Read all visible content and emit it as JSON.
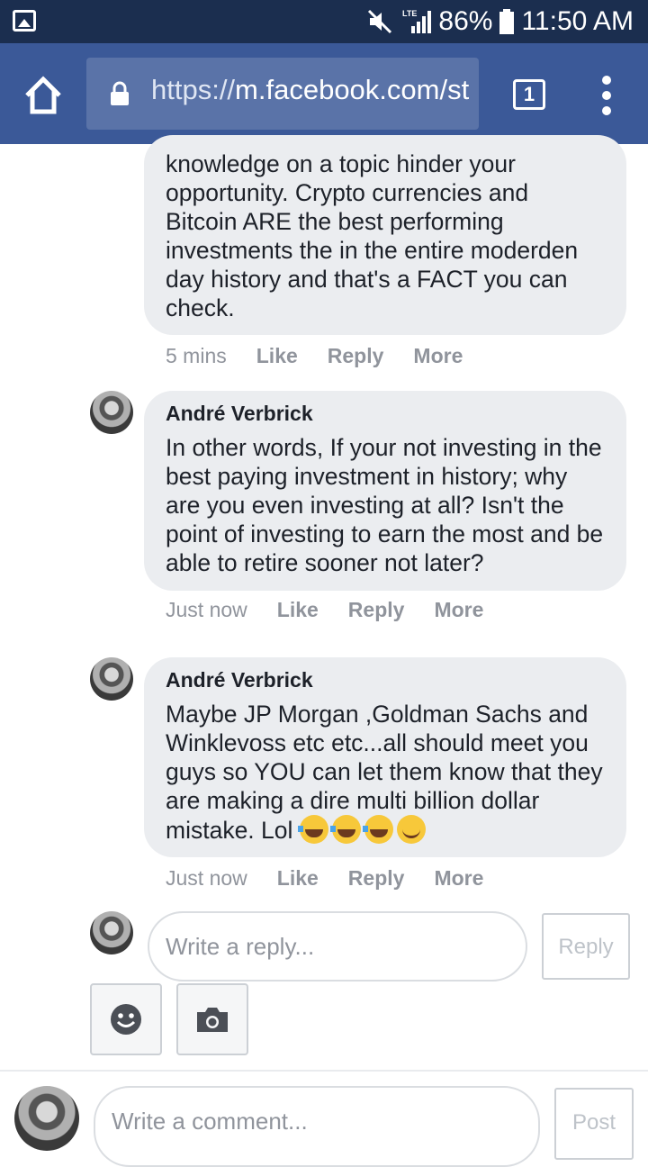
{
  "status_bar": {
    "network_label": "LTE",
    "battery": "86%",
    "time": "11:50 AM"
  },
  "browser": {
    "url_prefix": "https://",
    "url_host": "m.facebook.com/st",
    "tab_count": "1"
  },
  "comments": [
    {
      "author": "",
      "text": "knowledge on a topic hinder your opportunity. Crypto currencies and Bitcoin ARE the best performing investments the in the entire moderden day history and that's a FACT you can check.",
      "time": "5 mins"
    },
    {
      "author": "André Verbrick",
      "text": "In other words, If your not investing in the best paying investment in history; why are you even investing at all? Isn't the point of investing to earn the most and be able to retire sooner not later?",
      "time": "Just now"
    },
    {
      "author": "André Verbrick",
      "text": "Maybe JP Morgan ,Goldman Sachs and Winklevoss etc etc...all should meet you guys so YOU can let them know that they are making a dire multi billion dollar mistake. Lol",
      "time": "Just now",
      "emojis": [
        "face-with-tears-of-joy-icon",
        "face-with-tears-of-joy-icon",
        "face-with-tears-of-joy-icon",
        "smiling-face-icon"
      ]
    }
  ],
  "actions": {
    "like": "Like",
    "reply": "Reply",
    "more": "More"
  },
  "reply_box": {
    "placeholder": "Write a reply...",
    "button": "Reply"
  },
  "comment_box": {
    "placeholder": "Write a comment...",
    "button": "Post"
  },
  "colors": {
    "status_bar": "#1b2e4f",
    "browser_bar": "#3b5998",
    "bubble": "#ebedf0"
  }
}
